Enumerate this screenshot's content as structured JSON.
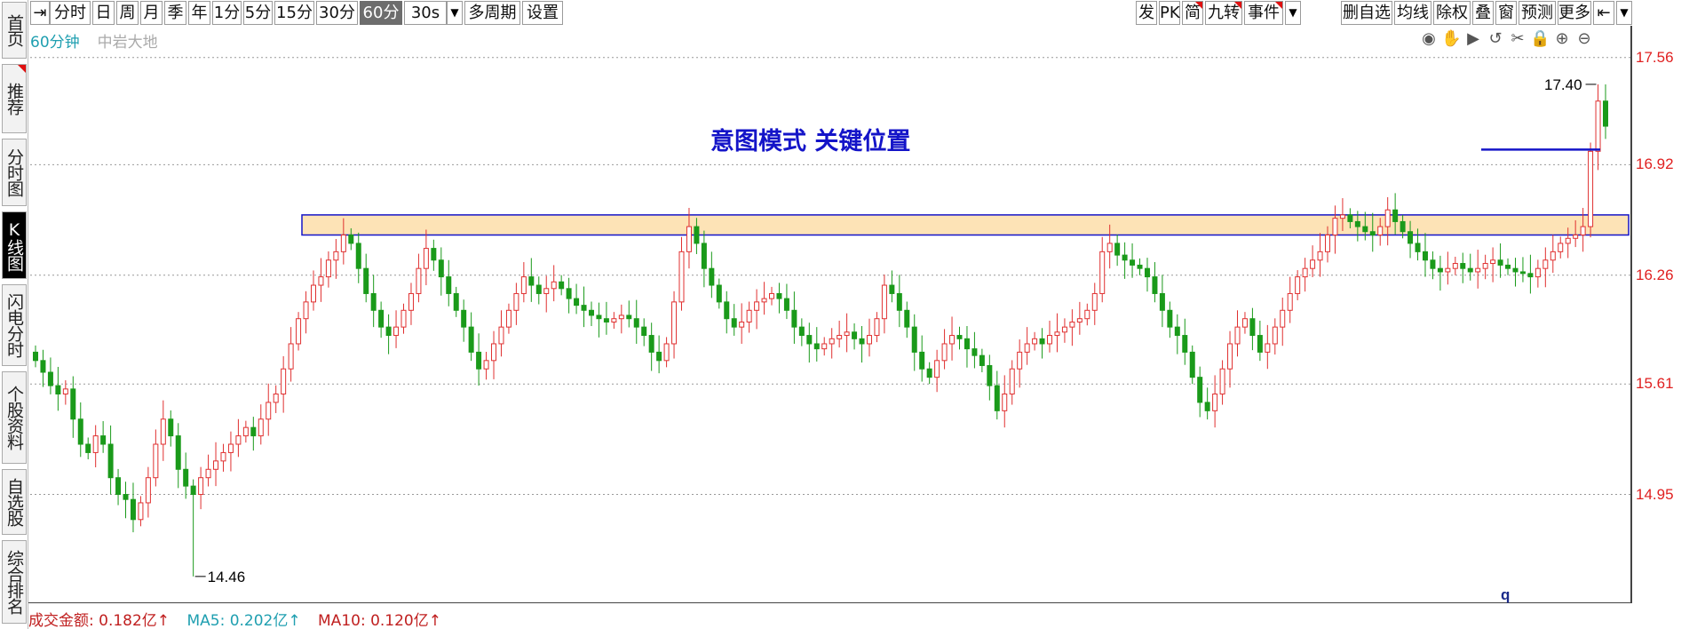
{
  "sidebar": {
    "tabs": [
      {
        "label": "首页",
        "active": false
      },
      {
        "label": "推荐",
        "active": false,
        "prefix": "⏯"
      },
      {
        "label": "分时图",
        "active": false
      },
      {
        "label": "K线图",
        "active": true
      },
      {
        "label": "闪电分时",
        "active": false
      },
      {
        "label": "个股资料",
        "active": false
      },
      {
        "label": "自选股",
        "active": false
      },
      {
        "label": "综合排名",
        "active": false
      }
    ]
  },
  "toolbar": {
    "left_icon": "⇥",
    "periods": [
      "分时",
      "日",
      "周",
      "月",
      "季",
      "年",
      "1分",
      "5分",
      "15分",
      "30分",
      "60分"
    ],
    "active_period": "60分",
    "speed": "30s",
    "multi_period": "多周期",
    "settings": "设置",
    "right_items": [
      "发",
      "PK",
      "简",
      "九转",
      "事件",
      "删自选",
      "均线",
      "除权",
      "叠",
      "窗",
      "预测",
      "更多"
    ]
  },
  "chart_header": {
    "period_label": "60分钟",
    "stock_name": "中岩大地"
  },
  "chart_tools": [
    "eye-icon",
    "hand-icon",
    "play-icon",
    "undo-icon",
    "scissors-icon",
    "lock-icon",
    "zoom-in-icon",
    "zoom-out-icon"
  ],
  "annotation": {
    "title": "意图模式  关键位置",
    "high_label": "17.40",
    "low_label": "14.46",
    "marker": "q"
  },
  "price_axis": [
    "17.56",
    "16.92",
    "16.26",
    "15.61",
    "14.95"
  ],
  "footer": {
    "turnover": "成交金额: 0.182亿↑",
    "ma5": "MA5: 0.202亿↑",
    "ma10": "MA10: 0.120亿↑"
  },
  "colors": {
    "up": "#e03030",
    "down": "#1a9a1a",
    "zone_fill": "#fde3b6",
    "zone_border": "#1515c8",
    "annotation_text": "#1414c8",
    "price_label": "#e02020",
    "ma5": "#1f9fb0",
    "ma10": "#c02020"
  },
  "chart_data": {
    "type": "candlestick",
    "title": "",
    "y_axis_ticks": [
      17.56,
      16.92,
      16.26,
      15.61,
      14.95
    ],
    "ylim": [
      14.3,
      17.75
    ],
    "high": 17.4,
    "low": 14.46,
    "key_zone": [
      16.5,
      16.62
    ],
    "resistance_line": 17.01,
    "grid": true,
    "close_series": [
      15.75,
      15.68,
      15.6,
      15.55,
      15.58,
      15.4,
      15.25,
      15.2,
      15.3,
      15.25,
      15.05,
      14.95,
      14.92,
      14.8,
      14.9,
      15.05,
      15.25,
      15.4,
      15.3,
      15.1,
      15.0,
      14.95,
      15.05,
      15.1,
      15.15,
      15.2,
      15.25,
      15.3,
      15.35,
      15.3,
      15.4,
      15.5,
      15.55,
      15.7,
      15.85,
      16.0,
      16.1,
      16.2,
      16.25,
      16.35,
      16.4,
      16.5,
      16.45,
      16.3,
      16.15,
      16.05,
      15.95,
      15.9,
      15.95,
      16.05,
      16.15,
      16.3,
      16.42,
      16.35,
      16.25,
      16.15,
      16.05,
      15.95,
      15.8,
      15.7,
      15.75,
      15.85,
      15.95,
      16.05,
      16.15,
      16.25,
      16.2,
      16.15,
      16.18,
      16.22,
      16.18,
      16.12,
      16.08,
      16.05,
      16.02,
      16.0,
      15.98,
      16.0,
      16.02,
      16.0,
      15.95,
      15.9,
      15.8,
      15.75,
      15.85,
      16.1,
      16.4,
      16.55,
      16.45,
      16.3,
      16.2,
      16.1,
      16.0,
      15.95,
      15.98,
      16.05,
      16.1,
      16.12,
      16.15,
      16.12,
      16.05,
      15.95,
      15.9,
      15.85,
      15.82,
      15.85,
      15.88,
      15.9,
      15.92,
      15.88,
      15.85,
      15.9,
      16.0,
      16.2,
      16.15,
      16.05,
      15.95,
      15.8,
      15.7,
      15.65,
      15.75,
      15.85,
      15.9,
      15.88,
      15.82,
      15.78,
      15.72,
      15.6,
      15.45,
      15.55,
      15.7,
      15.8,
      15.85,
      15.88,
      15.85,
      15.9,
      15.92,
      15.95,
      15.98,
      16.0,
      16.05,
      16.15,
      16.4,
      16.45,
      16.38,
      16.35,
      16.32,
      16.3,
      16.25,
      16.15,
      16.05,
      15.95,
      15.9,
      15.8,
      15.65,
      15.5,
      15.45,
      15.55,
      15.7,
      15.85,
      15.95,
      16.0,
      15.9,
      15.8,
      15.85,
      15.95,
      16.05,
      16.15,
      16.25,
      16.3,
      16.35,
      16.4,
      16.5,
      16.6,
      16.62,
      16.58,
      16.55,
      16.52,
      16.5,
      16.55,
      16.65,
      16.58,
      16.52,
      16.45,
      16.4,
      16.35,
      16.3,
      16.28,
      16.3,
      16.33,
      16.3,
      16.28,
      16.3,
      16.33,
      16.35,
      16.32,
      16.3,
      16.28,
      16.27,
      16.25,
      16.3,
      16.35,
      16.4,
      16.45,
      16.48,
      16.5,
      16.55,
      17.0,
      17.3,
      17.15
    ]
  }
}
